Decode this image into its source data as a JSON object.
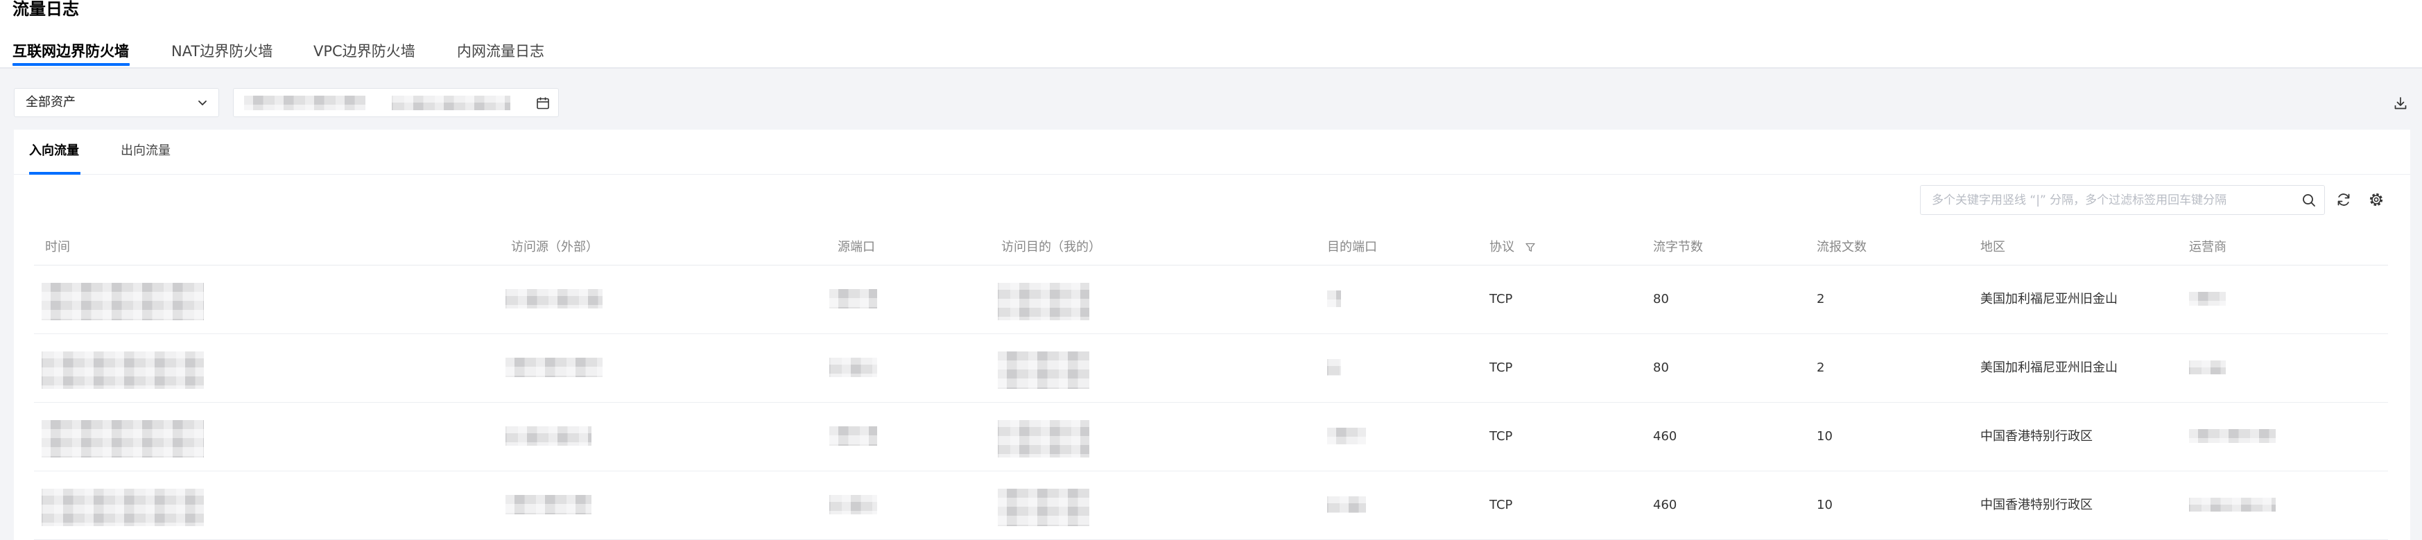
{
  "page": {
    "title": "流量日志"
  },
  "main_tabs": [
    {
      "label": "互联网边界防火墙",
      "active": true
    },
    {
      "label": "NAT边界防火墙",
      "active": false
    },
    {
      "label": "VPC边界防火墙",
      "active": false
    },
    {
      "label": "内网流量日志",
      "active": false
    }
  ],
  "filters": {
    "asset_select": {
      "selected": "全部资产",
      "icon": "chevron-down-icon"
    },
    "date_range": {
      "icon": "calendar-icon"
    },
    "download": {
      "icon": "download-icon"
    }
  },
  "direction_tabs": [
    {
      "label": "入向流量",
      "active": true
    },
    {
      "label": "出向流量",
      "active": false
    }
  ],
  "toolbar": {
    "search_placeholder": "多个关键字用竖线 “|” 分隔，多个过滤标签用回车键分隔",
    "icons": [
      "search-icon",
      "refresh-icon",
      "settings-icon"
    ]
  },
  "table": {
    "columns": [
      "时间",
      "访问源（外部）",
      "源端口",
      "访问目的（我的）",
      "目的端口",
      "协议",
      "流字节数",
      "流报文数",
      "地区",
      "运营商"
    ],
    "protocol_filter_icon": "filter-icon",
    "rows": [
      {
        "protocol": "TCP",
        "flow_bytes": 80,
        "flow_packets": 2,
        "region": "美国加利福尼亚州旧金山"
      },
      {
        "protocol": "TCP",
        "flow_bytes": 80,
        "flow_packets": 2,
        "region": "美国加利福尼亚州旧金山"
      },
      {
        "protocol": "TCP",
        "flow_bytes": 460,
        "flow_packets": 10,
        "region": "中国香港特别行政区"
      },
      {
        "protocol": "TCP",
        "flow_bytes": 460,
        "flow_packets": 10,
        "region": "中国香港特别行政区"
      }
    ]
  },
  "colors": {
    "accent": "#006eff",
    "background": "#f3f4f7",
    "header_text": "#888888"
  }
}
